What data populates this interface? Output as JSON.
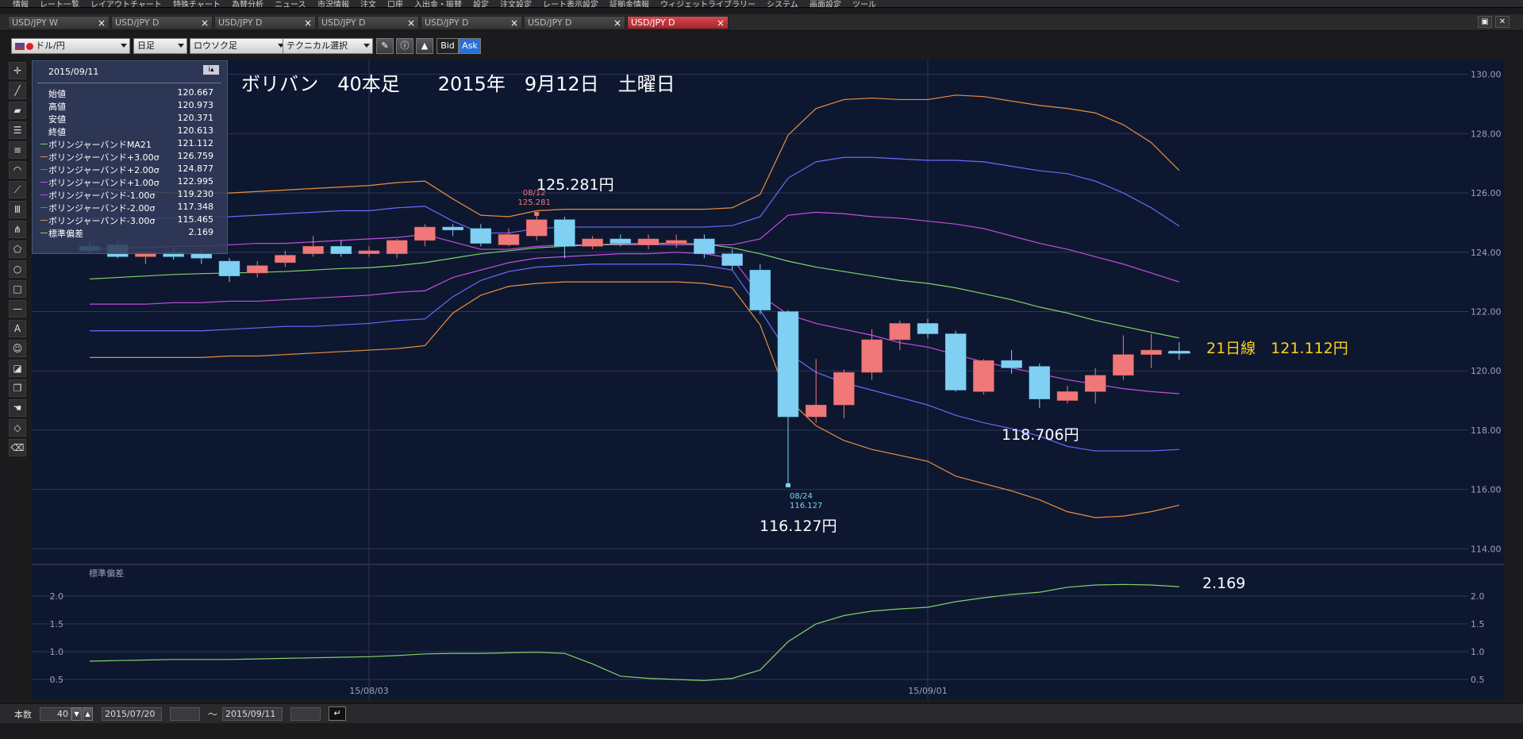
{
  "menubar": {
    "items": [
      "情報",
      "レート一覧",
      "レイアウトチャート",
      "特殊チャート",
      "為替分析",
      "ニュース",
      "市況情報",
      "注文",
      "口座",
      "入出金・振替",
      "設定",
      "注文設定",
      "レート表示設定",
      "証拠金情報",
      "ウィジェットライブラリー",
      "システム",
      "画面設定",
      "ツール"
    ]
  },
  "tabs": [
    {
      "label": "USD/JPY W"
    },
    {
      "label": "USD/JPY D"
    },
    {
      "label": "USD/JPY D"
    },
    {
      "label": "USD/JPY D"
    },
    {
      "label": "USD/JPY D"
    },
    {
      "label": "USD/JPY D"
    },
    {
      "label": "USD/JPY D",
      "active": true
    }
  ],
  "toolbar": {
    "pair": "ドル/円",
    "timeframe": "日足",
    "chart_type": "ロウソク足",
    "technical": "テクニカル選択",
    "bid": "Bid",
    "ask": "Ask"
  },
  "info_panel": {
    "date": "2015/09/11",
    "rows": [
      {
        "label": "始値",
        "value": "120.667",
        "color": ""
      },
      {
        "label": "高値",
        "value": "120.973",
        "color": ""
      },
      {
        "label": "安値",
        "value": "120.371",
        "color": ""
      },
      {
        "label": "終値",
        "value": "120.613",
        "color": ""
      },
      {
        "label": "ボリンジャーバンドMA21",
        "value": "121.112",
        "color": "#7fd36a"
      },
      {
        "label": "ボリンジャーバンド+3.00σ",
        "value": "126.759",
        "color": "#e89040"
      },
      {
        "label": "ボリンジャーバンド+2.00σ",
        "value": "124.877",
        "color": "#6a6aff"
      },
      {
        "label": "ボリンジャーバンド+1.00σ",
        "value": "122.995",
        "color": "#c050e0"
      },
      {
        "label": "ボリンジャーバンド-1.00σ",
        "value": "119.230",
        "color": "#c050e0"
      },
      {
        "label": "ボリンジャーバンド-2.00σ",
        "value": "117.348",
        "color": "#6a6aff"
      },
      {
        "label": "ボリンジャーバンド-3.00σ",
        "value": "115.465",
        "color": "#e89040"
      },
      {
        "label": "標準偏差",
        "value": "2.169",
        "color": "#7fd36a"
      }
    ]
  },
  "annotations": {
    "title": "ボリバン　40本足　　2015年　9月12日　土曜日",
    "high_label": "125.281円",
    "high_mark": {
      "date": "08/12",
      "value": "125.281"
    },
    "low_label": "116.127円",
    "low_mark": {
      "date": "08/24",
      "value": "116.127"
    },
    "mid_label": "118.706円",
    "ma_label": "21日線　121.112円",
    "sd_label": "2.169"
  },
  "colors": {
    "bull": "#f07878",
    "bear": "#7fd0f2",
    "ma": "#7fd36a",
    "s3": "#e89040",
    "s2": "#6a6aff",
    "s1": "#c050e0",
    "bg": "#0e1730"
  },
  "bottom": {
    "count_label": "本数",
    "count": "40",
    "from": "2015/07/20",
    "to_sep": "〜",
    "to": "2015/09/11"
  },
  "chart_data": {
    "type": "candlestick",
    "ylim": [
      113.5,
      130.5
    ],
    "yticks": [
      "130.00",
      "128.00",
      "126.00",
      "124.00",
      "122.00",
      "120.00",
      "118.00",
      "116.00",
      "114.00"
    ],
    "xlabels": [
      {
        "i": 10,
        "text": "15/08/03"
      },
      {
        "i": 30,
        "text": "15/09/01"
      }
    ],
    "candles": [
      {
        "o": 124.2,
        "h": 124.4,
        "l": 123.95,
        "c": 124.05
      },
      {
        "o": 124.25,
        "h": 124.4,
        "l": 123.8,
        "c": 123.85
      },
      {
        "o": 123.85,
        "h": 124.05,
        "l": 123.6,
        "c": 124.0
      },
      {
        "o": 124.0,
        "h": 124.15,
        "l": 123.75,
        "c": 123.85
      },
      {
        "o": 123.95,
        "h": 124.1,
        "l": 123.6,
        "c": 123.8
      },
      {
        "o": 123.7,
        "h": 123.8,
        "l": 123.0,
        "c": 123.2
      },
      {
        "o": 123.3,
        "h": 123.7,
        "l": 123.15,
        "c": 123.55
      },
      {
        "o": 123.65,
        "h": 124.05,
        "l": 123.5,
        "c": 123.9
      },
      {
        "o": 123.95,
        "h": 124.55,
        "l": 123.85,
        "c": 124.2
      },
      {
        "o": 124.2,
        "h": 124.4,
        "l": 123.85,
        "c": 123.95
      },
      {
        "o": 123.95,
        "h": 124.2,
        "l": 123.85,
        "c": 124.05
      },
      {
        "o": 123.95,
        "h": 124.45,
        "l": 123.8,
        "c": 124.4
      },
      {
        "o": 124.4,
        "h": 124.95,
        "l": 124.2,
        "c": 124.85
      },
      {
        "o": 124.85,
        "h": 124.95,
        "l": 124.55,
        "c": 124.75
      },
      {
        "o": 124.8,
        "h": 124.95,
        "l": 124.2,
        "c": 124.3
      },
      {
        "o": 124.25,
        "h": 124.8,
        "l": 124.2,
        "c": 124.6
      },
      {
        "o": 124.55,
        "h": 125.28,
        "l": 124.4,
        "c": 125.1
      },
      {
        "o": 125.1,
        "h": 125.2,
        "l": 123.8,
        "c": 124.2
      },
      {
        "o": 124.2,
        "h": 124.55,
        "l": 124.1,
        "c": 124.45
      },
      {
        "o": 124.45,
        "h": 124.6,
        "l": 124.2,
        "c": 124.3
      },
      {
        "o": 124.25,
        "h": 124.6,
        "l": 124.1,
        "c": 124.45
      },
      {
        "o": 124.3,
        "h": 124.6,
        "l": 124.15,
        "c": 124.4
      },
      {
        "o": 124.45,
        "h": 124.6,
        "l": 123.8,
        "c": 123.95
      },
      {
        "o": 123.95,
        "h": 124.1,
        "l": 123.4,
        "c": 123.55
      },
      {
        "o": 123.4,
        "h": 123.6,
        "l": 121.9,
        "c": 122.05
      },
      {
        "o": 122.0,
        "h": 122.05,
        "l": 116.13,
        "c": 118.45
      },
      {
        "o": 118.45,
        "h": 120.4,
        "l": 118.25,
        "c": 118.85
      },
      {
        "o": 118.85,
        "h": 120.05,
        "l": 118.4,
        "c": 119.95
      },
      {
        "o": 119.95,
        "h": 121.4,
        "l": 119.7,
        "c": 121.05
      },
      {
        "o": 121.05,
        "h": 121.7,
        "l": 120.7,
        "c": 121.6
      },
      {
        "o": 121.6,
        "h": 121.75,
        "l": 121.1,
        "c": 121.25
      },
      {
        "o": 121.25,
        "h": 121.35,
        "l": 119.3,
        "c": 119.35
      },
      {
        "o": 119.3,
        "h": 120.4,
        "l": 119.2,
        "c": 120.35
      },
      {
        "o": 120.35,
        "h": 120.7,
        "l": 119.9,
        "c": 120.1
      },
      {
        "o": 120.15,
        "h": 120.25,
        "l": 118.75,
        "c": 119.05
      },
      {
        "o": 119.0,
        "h": 119.5,
        "l": 118.9,
        "c": 119.3
      },
      {
        "o": 119.3,
        "h": 120.1,
        "l": 118.9,
        "c": 119.85
      },
      {
        "o": 119.85,
        "h": 121.2,
        "l": 119.7,
        "c": 120.55
      },
      {
        "o": 120.55,
        "h": 121.25,
        "l": 120.1,
        "c": 120.7
      },
      {
        "o": 120.67,
        "h": 120.97,
        "l": 120.37,
        "c": 120.61
      }
    ],
    "bands_x_start": 0,
    "ma21": [
      123.1,
      123.15,
      123.2,
      123.25,
      123.28,
      123.3,
      123.32,
      123.35,
      123.4,
      123.45,
      123.48,
      123.55,
      123.65,
      123.8,
      123.95,
      124.05,
      124.15,
      124.2,
      124.25,
      124.28,
      124.3,
      124.3,
      124.28,
      124.15,
      123.95,
      123.7,
      123.5,
      123.35,
      123.2,
      123.05,
      122.95,
      122.8,
      122.6,
      122.4,
      122.15,
      121.95,
      121.7,
      121.5,
      121.3,
      121.11
    ],
    "u3": [
      126.15,
      126.1,
      126.05,
      126.0,
      126.0,
      126.0,
      126.05,
      126.1,
      126.15,
      126.2,
      126.25,
      126.35,
      126.4,
      125.8,
      125.25,
      125.2,
      125.4,
      125.45,
      125.45,
      125.45,
      125.45,
      125.45,
      125.45,
      125.5,
      125.95,
      127.95,
      128.85,
      129.15,
      129.2,
      129.15,
      129.15,
      129.3,
      129.25,
      129.1,
      128.95,
      128.85,
      128.7,
      128.3,
      127.7,
      126.76
    ],
    "u2": [
      125.15,
      125.15,
      125.15,
      125.15,
      125.2,
      125.2,
      125.25,
      125.3,
      125.35,
      125.4,
      125.4,
      125.5,
      125.55,
      125.05,
      124.65,
      124.65,
      124.8,
      124.85,
      124.85,
      124.85,
      124.85,
      124.85,
      124.85,
      124.9,
      125.2,
      126.5,
      127.05,
      127.2,
      127.2,
      127.15,
      127.1,
      127.1,
      127.05,
      126.9,
      126.75,
      126.65,
      126.4,
      126.0,
      125.5,
      124.88
    ],
    "u1": [
      124.1,
      124.15,
      124.15,
      124.2,
      124.2,
      124.25,
      124.3,
      124.3,
      124.35,
      124.4,
      124.45,
      124.5,
      124.6,
      124.35,
      124.1,
      124.1,
      124.2,
      124.25,
      124.25,
      124.25,
      124.25,
      124.25,
      124.25,
      124.25,
      124.45,
      125.25,
      125.35,
      125.3,
      125.2,
      125.15,
      125.05,
      124.95,
      124.8,
      124.55,
      124.3,
      124.1,
      123.85,
      123.6,
      123.3,
      123.0
    ],
    "l1": [
      122.25,
      122.25,
      122.25,
      122.3,
      122.3,
      122.35,
      122.35,
      122.4,
      122.45,
      122.5,
      122.55,
      122.65,
      122.7,
      123.15,
      123.4,
      123.65,
      123.8,
      123.85,
      123.9,
      123.95,
      123.95,
      124.0,
      123.95,
      123.8,
      122.55,
      121.9,
      121.6,
      121.4,
      121.2,
      120.95,
      120.8,
      120.55,
      120.3,
      120.1,
      119.9,
      119.7,
      119.55,
      119.4,
      119.3,
      119.23
    ],
    "l2": [
      121.35,
      121.35,
      121.35,
      121.35,
      121.35,
      121.4,
      121.45,
      121.5,
      121.5,
      121.55,
      121.6,
      121.7,
      121.75,
      122.5,
      123.05,
      123.35,
      123.5,
      123.55,
      123.6,
      123.6,
      123.6,
      123.6,
      123.55,
      123.4,
      122.05,
      120.6,
      119.95,
      119.6,
      119.35,
      119.1,
      118.85,
      118.5,
      118.25,
      118.05,
      117.8,
      117.45,
      117.3,
      117.3,
      117.3,
      117.35
    ],
    "l3": [
      120.45,
      120.45,
      120.45,
      120.45,
      120.45,
      120.5,
      120.5,
      120.55,
      120.6,
      120.65,
      120.7,
      120.75,
      120.85,
      121.95,
      122.55,
      122.85,
      122.95,
      123.0,
      123.0,
      123.0,
      123.0,
      123.0,
      122.95,
      122.8,
      121.55,
      119.05,
      118.15,
      117.65,
      117.35,
      117.15,
      116.95,
      116.45,
      116.2,
      115.95,
      115.65,
      115.25,
      115.05,
      115.1,
      115.25,
      115.47
    ],
    "stddev": {
      "ylim": [
        0.3,
        2.5
      ],
      "yticks": [
        "2.0",
        "1.5",
        "1.0",
        "0.5"
      ],
      "label": "標準偏差",
      "values": [
        0.83,
        0.84,
        0.85,
        0.86,
        0.86,
        0.86,
        0.87,
        0.88,
        0.89,
        0.9,
        0.91,
        0.93,
        0.96,
        0.97,
        0.97,
        0.98,
        0.99,
        0.97,
        0.78,
        0.56,
        0.52,
        0.5,
        0.48,
        0.52,
        0.67,
        1.18,
        1.5,
        1.65,
        1.73,
        1.77,
        1.8,
        1.9,
        1.97,
        2.03,
        2.07,
        2.16,
        2.2,
        2.21,
        2.2,
        2.17
      ]
    }
  }
}
